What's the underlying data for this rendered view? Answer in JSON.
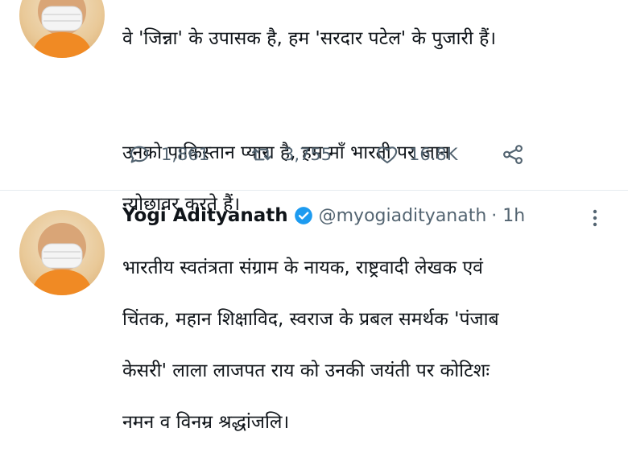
{
  "tweets": [
    {
      "text_lines": [
        "वे 'जिन्ना' के उपासक है, हम 'सरदार पटेल' के पुजारी हैं।",
        "",
        "उनको पाकिस्तान प्यारा है, हम माँ भारती पर जान",
        "न्योछावर करते हैं।"
      ],
      "metrics": {
        "replies": "1,861",
        "retweets": "3,755",
        "likes": "16.8K"
      }
    },
    {
      "author": {
        "name": "Yogi Adityanath",
        "handle": "@myogiadityanath",
        "time": "· 1h"
      },
      "text_lines": [
        "भारतीय स्वतंत्रता संग्राम के नायक, राष्ट्रवादी लेखक एवं",
        "चिंतक, महान शिक्षाविद, स्वराज के प्रबल समर्थक 'पंजाब",
        "केसरी' लाला लाजपत राय को उनकी जयंती पर कोटिशः",
        "नमन व विनम्र श्रद्धांजलि।"
      ]
    }
  ],
  "colors": {
    "secondary": "#536471",
    "verified": "#1d9bf0",
    "divider": "#e6ecf0"
  },
  "icons": [
    "reply-icon",
    "retweet-icon",
    "like-icon",
    "share-icon",
    "verified-badge-icon",
    "more-icon"
  ]
}
